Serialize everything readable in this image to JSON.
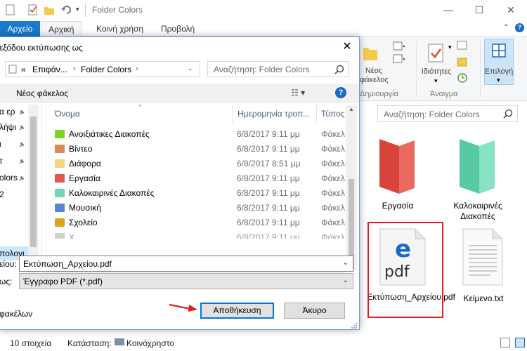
{
  "explorer": {
    "title": "Folder Colors",
    "tabs": [
      "Αρχείο",
      "Αρχική",
      "Κοινή χρήση",
      "Προβολή"
    ],
    "ribbon": {
      "new_folder_label_1": "Νέος",
      "new_folder_label_2": "φάκελος",
      "group_create": "Δημιουργία",
      "properties_label": "Ιδιότητες",
      "group_open": "Άνοιγμα",
      "select_label": "Επιλογή"
    },
    "search_placeholder": "Αναζήτηση: Folder Colors",
    "items": [
      {
        "name": "Εργασία",
        "icon": "folder-icon",
        "color": "#e2574c"
      },
      {
        "name": "Καλοκαιρινές Διακοπές",
        "icon": "folder-icon",
        "color": "#6fd8b2"
      },
      {
        "name": "Εκτύπωση_Αρχείου.pdf",
        "icon": "pdf-file-icon",
        "color": "#1a69c6"
      },
      {
        "name": "Κείμενο.txt",
        "icon": "text-file-icon",
        "color": "#888888"
      }
    ],
    "status": {
      "count": "10 στοιχεία",
      "state_label": "Κατάσταση:",
      "state_value": "Κοινόχρηστο"
    }
  },
  "dialog": {
    "title": "εξόδου εκτύπωσης ως",
    "breadcrumb": [
      "«",
      "Επιφάν...",
      "Folder Colors"
    ],
    "search_placeholder": "Αναζήτηση: Folder Colors",
    "new_folder": "Νέος φάκελος",
    "help": "?",
    "nav_items": [
      {
        "label": "α ερ",
        "pinned": true
      },
      {
        "label": "λήψι",
        "pinned": true
      },
      {
        "label": "ι",
        "pinned": true
      },
      {
        "label": "τ",
        "pinned": true
      },
      {
        "label": "olors",
        "pinned": true
      },
      {
        "label": "2",
        "pinned": false
      },
      {
        "label": "πολογι",
        "pinned": false,
        "selected": true
      }
    ],
    "columns": [
      "Όνομα",
      "Ημερομηνία τροπ...",
      "Τύπος"
    ],
    "files": [
      {
        "name": "Ανοιξιάτικες Διακοπές",
        "date": "6/8/2017 9:11 μμ",
        "type": "Φάκελ",
        "color": "#7fd321"
      },
      {
        "name": "Βίντεο",
        "date": "6/8/2017 9:11 μμ",
        "type": "Φάκελ",
        "color": "#d98a55"
      },
      {
        "name": "Διάφορα",
        "date": "6/8/2017 8:51 μμ",
        "type": "Φάκελ",
        "color": "#f5d67b"
      },
      {
        "name": "Εργασία",
        "date": "6/8/2017 9:11 μμ",
        "type": "Φάκελ",
        "color": "#e2574c"
      },
      {
        "name": "Καλοκαιρινές Διακοπές",
        "date": "6/8/2017 9:11 μμ",
        "type": "Φάκελ",
        "color": "#6fd8b2"
      },
      {
        "name": "Μουσική",
        "date": "6/8/2017 9:11 μμ",
        "type": "Φάκελ",
        "color": "#5a86d6"
      },
      {
        "name": "Σχολείο",
        "date": "6/8/2017 9:11 μμ",
        "type": "Φάκελ",
        "color": "#e0a21a"
      },
      {
        "name": "Χ...",
        "date": "6/8/2017 9:11 μμ",
        "type": "Φάκελ",
        "color": "#cfcfcf"
      }
    ],
    "filename_label": "είου:",
    "filename_value": "Εκτύπωση_Αρχείου.pdf",
    "filetype_label": "ως:",
    "filetype_value": "Έγγραφο PDF (*.pdf)",
    "hide_folders": "φακέλων",
    "save_button": "Αποθήκευση",
    "cancel_button": "Άκυρο",
    "accent": "#0078d7"
  }
}
